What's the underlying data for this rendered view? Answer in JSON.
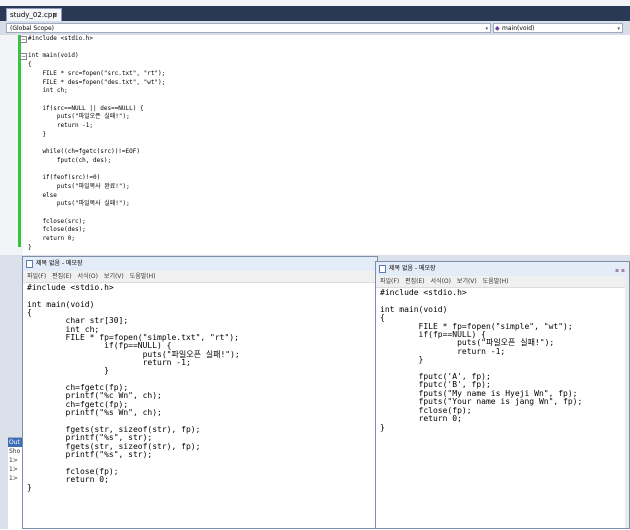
{
  "editor": {
    "tab": {
      "label": "study_02.cpp",
      "close": "×"
    },
    "scope_left": "(Global Scope)",
    "scope_right": "main(void)",
    "dropdown_arrow": "▾",
    "code": "#include <stdio.h>\n\nint main(void)\n{\n    FILE * src=fopen(\"src.txt\", \"rt\");\n    FILE * des=fopen(\"des.txt\", \"wt\");\n    int ch;\n\n    if(src==NULL || des==NULL) {\n        puts(\"파일오픈 실패!\");\n        return -1;\n    }\n\n    while((ch=fgetc(src))!=EOF)\n        fputc(ch, des);\n\n    if(feof(src)!=0)\n        puts(\"파일복사 완료!\");\n    else\n        puts(\"파일복사 실패!\");\n\n    fclose(src);\n    fclose(des);\n    return 0;\n}"
  },
  "lower_panel": {
    "number": "100",
    "items": [
      "Out",
      "Sho",
      "1>",
      "1>",
      "1>"
    ]
  },
  "notepad_left": {
    "title": "제목 없음 - 메모장",
    "menu": [
      "파일(F)",
      "편집(E)",
      "서식(O)",
      "보기(V)",
      "도움말(H)"
    ],
    "text": "#include <stdio.h>\n\nint main(void)\n{\n        char str[30];\n        int ch;\n        FILE * fp=fopen(\"simple.txt\", \"rt\");\n                if(fp==NULL) {\n                        puts(\"파일오픈 실패!\");\n                        return -1;\n                }\n\n        ch=fgetc(fp);\n        printf(\"%c Wn\", ch);\n        ch=fgetc(fp);\n        printf(\"%s Wn\", ch);\n\n        fgets(str, sizeof(str), fp);\n        printf(\"%s\", str);\n        fgets(str, sizeof(str), fp);\n        printf(\"%s\", str);\n\n        fclose(fp);\n        return 0;\n}"
  },
  "notepad_right": {
    "title": "제목 없음 - 메모장",
    "menu": [
      "파일(F)",
      "편집(E)",
      "서식(O)",
      "보기(V)",
      "도움말(H)"
    ],
    "text": "#include <stdio.h>\n\nint main(void)\n{\n        FILE * fp=fopen(\"simple\", \"wt\");\n        if(fp==NULL) {\n                puts(\"파일오픈 실패!\");\n                return -1;\n        }\n\n        fputc('A', fp);\n        fputc('B', fp);\n        fputs(\"My name is Hyeji Wn\", fp);\n        fputs(\"Your name is jang Wn\", fp);\n        fclose(fp);\n        return 0;\n}"
  }
}
